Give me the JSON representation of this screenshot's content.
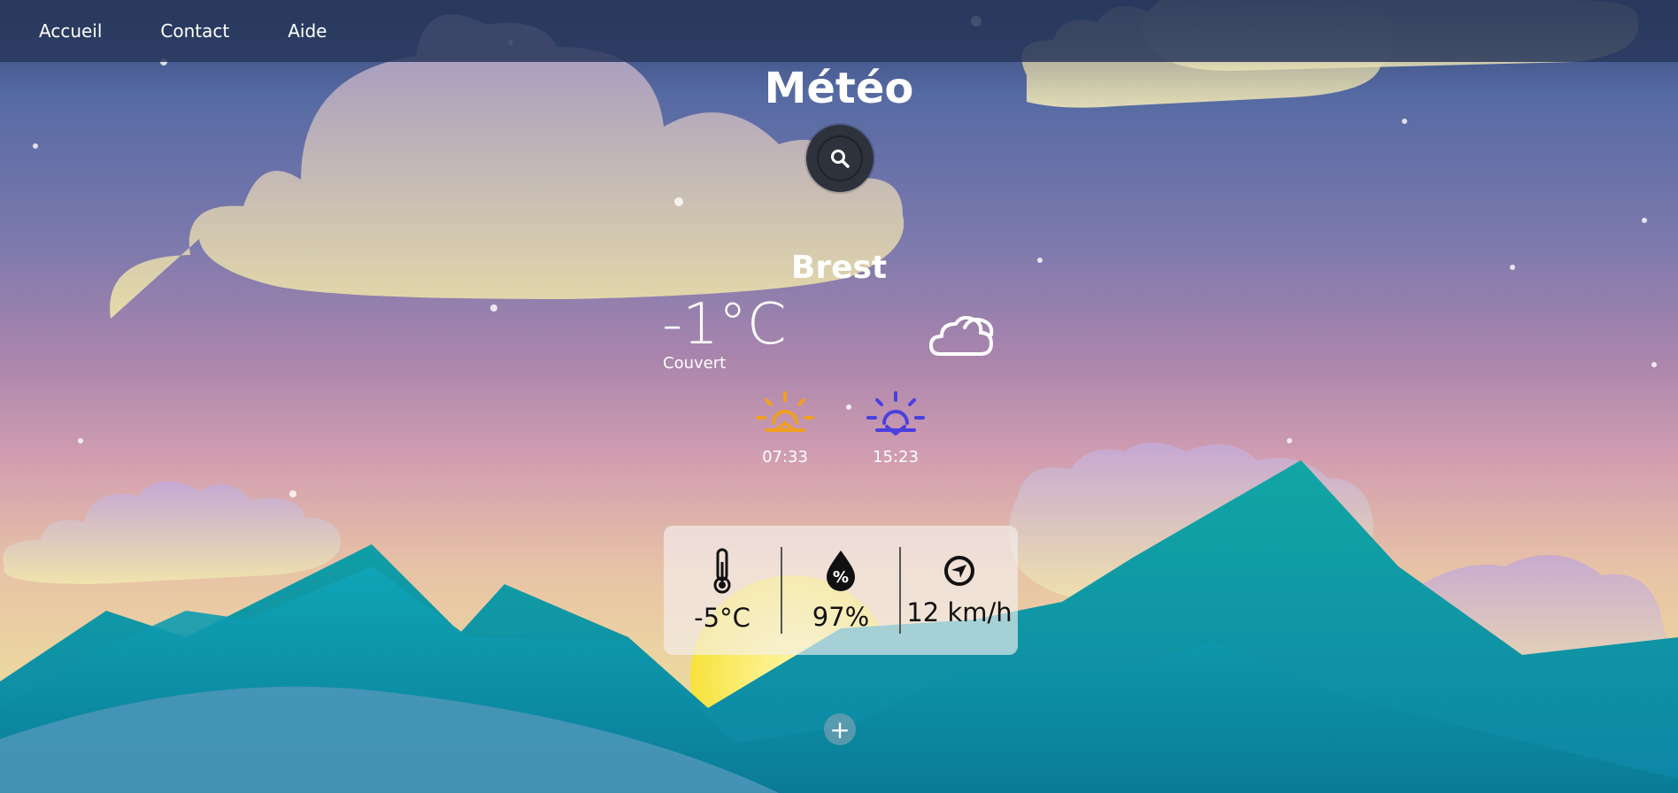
{
  "nav": {
    "items": [
      {
        "label": "Accueil"
      },
      {
        "label": "Contact"
      },
      {
        "label": "Aide"
      }
    ]
  },
  "title": "Météo",
  "weather": {
    "city": "Brest",
    "temperature": "-1°C",
    "condition": "Couvert",
    "sunrise": "07:33",
    "sunset": "15:23",
    "feels_like": "-5°C",
    "humidity": "97%",
    "wind": "12 km/h"
  },
  "icons": {
    "search": "search-icon",
    "condition": "cloud-icon",
    "sunrise": "sunrise-icon",
    "sunset": "sunset-icon",
    "feels_like": "thermometer-icon",
    "humidity": "humidity-drop-icon",
    "wind": "wind-direction-icon",
    "add": "plus-icon"
  },
  "colors": {
    "sunrise": "#f0a020",
    "sunset": "#4a3fe0",
    "panel": "#f5f0f0"
  },
  "add_label": "+"
}
